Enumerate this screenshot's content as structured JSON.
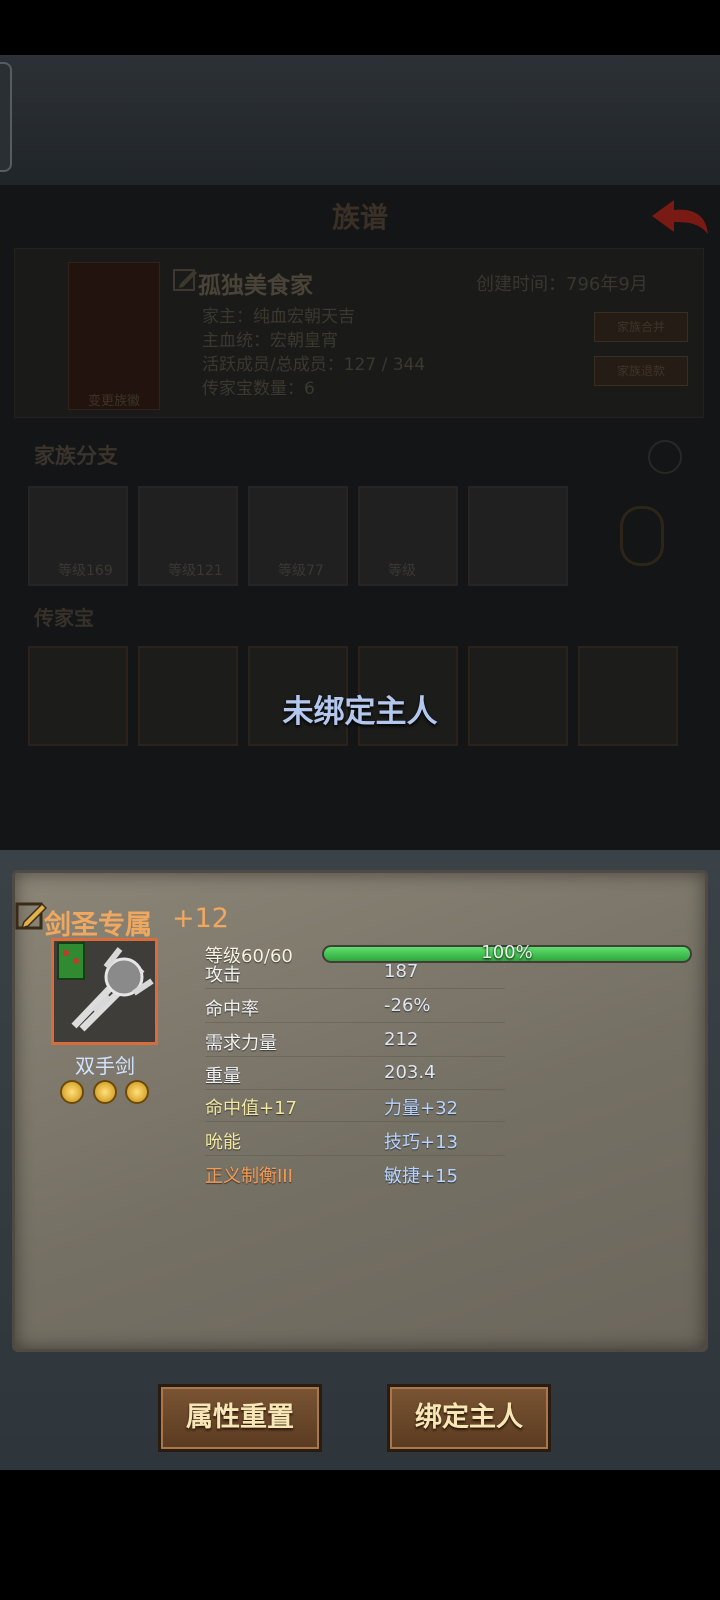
{
  "clan": {
    "title": "族谱",
    "name": "孤独美食家",
    "created": "创建时间：796年9月",
    "emblem_label": "变更族徽",
    "lines": [
      "家主：纯血宏朝天吉",
      "主血统：宏朝皇宵",
      "活跃成员/总成员：127 / 344",
      "传家宝数量：6"
    ],
    "buttons": [
      "家族合并",
      "家族退款"
    ],
    "branch_title": "家族分支",
    "branch_levels": [
      "等级169",
      "等级121",
      "等级77",
      "等级"
    ],
    "heirloom_title": "传家宝"
  },
  "overlay": {
    "unbound_text": "未绑定主人"
  },
  "item": {
    "name": "剑圣专属",
    "plus": "+12",
    "type": "双手剑",
    "gems": 3,
    "level_label": "等级60/60",
    "level_pct_text": "100%",
    "level_fraction": 1.0,
    "stats": [
      {
        "label": "攻击",
        "value": "187"
      },
      {
        "label": "命中率",
        "value": "-26%"
      },
      {
        "label": "需求力量",
        "value": "212"
      },
      {
        "label": "重量",
        "value": "203.4"
      }
    ],
    "bonuses": [
      {
        "label": "命中值+17",
        "value": "力量+32"
      },
      {
        "label": "吮能",
        "value": "技巧+13"
      },
      {
        "label": "正义制衡III",
        "value": "敏捷+15"
      }
    ]
  },
  "actions": {
    "reset": "属性重置",
    "bind": "绑定主人"
  },
  "colors": {
    "accent_orange": "#f0a85e",
    "bonus_yellow": "#f3e7a0",
    "bonus_blue": "#b6d4ff",
    "skill_orange": "#f59b55",
    "level_green": "#3fc24f"
  }
}
